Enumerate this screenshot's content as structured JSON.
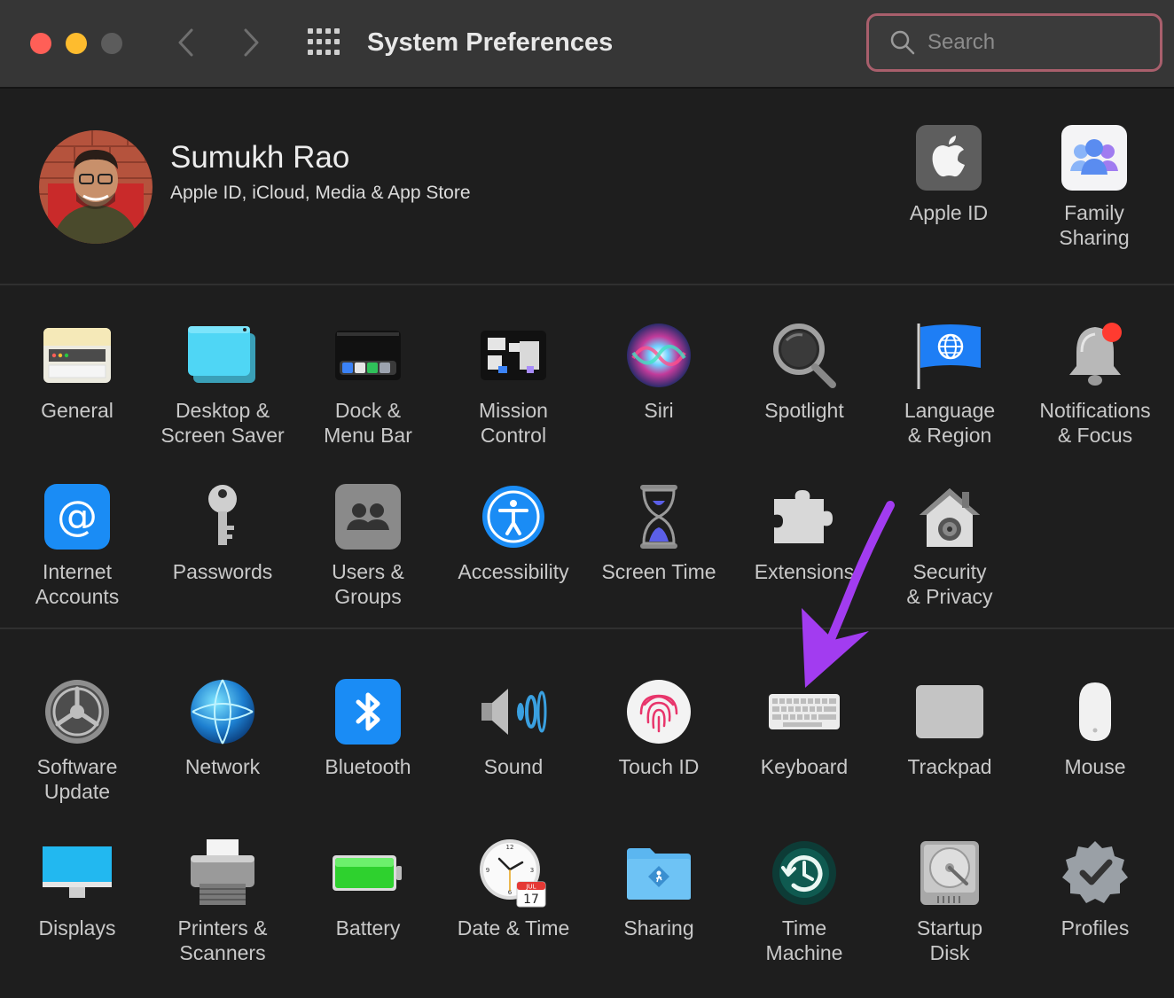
{
  "window": {
    "title": "System Preferences"
  },
  "search": {
    "placeholder": "Search"
  },
  "account": {
    "name": "Sumukh Rao",
    "subtitle": "Apple ID, iCloud, Media & App Store"
  },
  "top_panes": [
    {
      "label": "Apple ID",
      "icon": "apple-id-icon"
    },
    {
      "label": "Family\nSharing",
      "icon": "family-sharing-icon"
    }
  ],
  "section1": [
    {
      "label": "General",
      "icon": "general-icon"
    },
    {
      "label": "Desktop &\nScreen Saver",
      "icon": "desktop-screen-saver-icon"
    },
    {
      "label": "Dock &\nMenu Bar",
      "icon": "dock-menu-bar-icon"
    },
    {
      "label": "Mission\nControl",
      "icon": "mission-control-icon"
    },
    {
      "label": "Siri",
      "icon": "siri-icon"
    },
    {
      "label": "Spotlight",
      "icon": "spotlight-icon"
    },
    {
      "label": "Language\n& Region",
      "icon": "language-region-icon"
    },
    {
      "label": "Notifications\n& Focus",
      "icon": "notifications-focus-icon"
    },
    {
      "label": "Internet\nAccounts",
      "icon": "internet-accounts-icon"
    },
    {
      "label": "Passwords",
      "icon": "passwords-icon"
    },
    {
      "label": "Users &\nGroups",
      "icon": "users-groups-icon"
    },
    {
      "label": "Accessibility",
      "icon": "accessibility-icon"
    },
    {
      "label": "Screen Time",
      "icon": "screen-time-icon"
    },
    {
      "label": "Extensions",
      "icon": "extensions-icon"
    },
    {
      "label": "Security\n& Privacy",
      "icon": "security-privacy-icon"
    }
  ],
  "section2": [
    {
      "label": "Software\nUpdate",
      "icon": "software-update-icon"
    },
    {
      "label": "Network",
      "icon": "network-icon"
    },
    {
      "label": "Bluetooth",
      "icon": "bluetooth-icon"
    },
    {
      "label": "Sound",
      "icon": "sound-icon"
    },
    {
      "label": "Touch ID",
      "icon": "touch-id-icon"
    },
    {
      "label": "Keyboard",
      "icon": "keyboard-icon"
    },
    {
      "label": "Trackpad",
      "icon": "trackpad-icon"
    },
    {
      "label": "Mouse",
      "icon": "mouse-icon"
    },
    {
      "label": "Displays",
      "icon": "displays-icon"
    },
    {
      "label": "Printers &\nScanners",
      "icon": "printers-scanners-icon"
    },
    {
      "label": "Battery",
      "icon": "battery-icon"
    },
    {
      "label": "Date & Time",
      "icon": "date-time-icon"
    },
    {
      "label": "Sharing",
      "icon": "sharing-icon"
    },
    {
      "label": "Time\nMachine",
      "icon": "time-machine-icon"
    },
    {
      "label": "Startup\nDisk",
      "icon": "startup-disk-icon"
    },
    {
      "label": "Profiles",
      "icon": "profiles-icon"
    }
  ],
  "calendar_badge": {
    "month": "JUL",
    "day": "17"
  },
  "annotation": {
    "arrow_color": "#a23cf0",
    "target": "Keyboard"
  }
}
